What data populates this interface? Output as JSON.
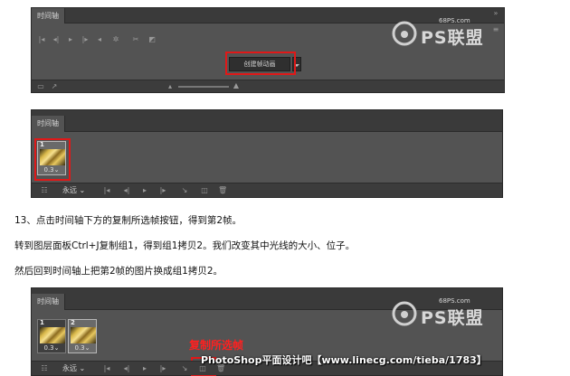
{
  "panel1": {
    "tab": "时间轴",
    "create_button": "创建帧动画",
    "watermark_site": "68PS.com",
    "watermark_brand": "PS联盟"
  },
  "panel2": {
    "tab": "时间轴",
    "frames": [
      {
        "number": "1",
        "delay": "0.3"
      }
    ],
    "loop": "永远"
  },
  "steps": [
    "13、点击时间轴下方的复制所选帧按钮，得到第2帧。",
    "转到图层面板Ctrl+J复制组1，得到组1拷贝2。我们改变其中光线的大小、位子。",
    "然后回到时间轴上把第2帧的图片换成组1拷贝2。"
  ],
  "panel3": {
    "tab": "时间轴",
    "frames": [
      {
        "number": "1",
        "delay": "0.3"
      },
      {
        "number": "2",
        "delay": "0.3"
      }
    ],
    "loop": "永远",
    "annotation": "复制所选帧",
    "watermark_site": "68PS.com",
    "watermark_brand": "PS联盟"
  },
  "footer_watermark": "PhotoShop平面设计吧【www.linecg.com/tieba/1783】",
  "colors": {
    "panel_bg": "#535353",
    "tab_bar": "#3a3a3a",
    "highlight_red": "#e01818"
  }
}
